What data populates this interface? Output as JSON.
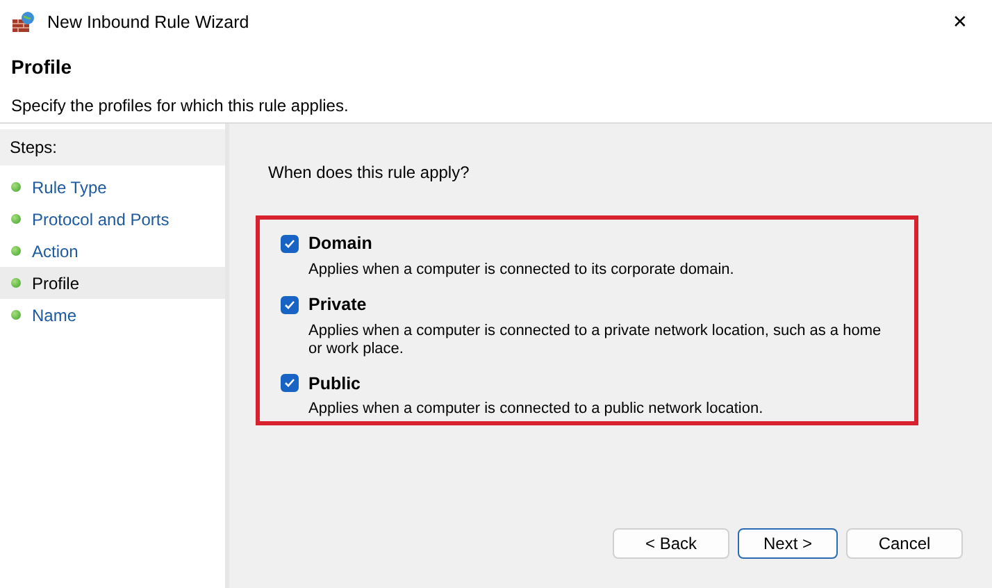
{
  "window": {
    "title": "New Inbound Rule Wizard",
    "close": "✕"
  },
  "header": {
    "title": "Profile",
    "subtitle": "Specify the profiles for which this rule applies."
  },
  "steps": {
    "heading": "Steps:",
    "items": [
      {
        "label": "Rule Type",
        "selected": false
      },
      {
        "label": "Protocol and Ports",
        "selected": false
      },
      {
        "label": "Action",
        "selected": false
      },
      {
        "label": "Profile",
        "selected": true
      },
      {
        "label": "Name",
        "selected": false
      }
    ]
  },
  "question": "When does this rule apply?",
  "profiles": [
    {
      "label": "Domain",
      "checked": true,
      "description": "Applies when a computer is connected to its corporate domain."
    },
    {
      "label": "Private",
      "checked": true,
      "description": "Applies when a computer is connected to a private network location, such as a home or work place."
    },
    {
      "label": "Public",
      "checked": true,
      "description": "Applies when a computer is connected to a public network location."
    }
  ],
  "buttons": [
    {
      "label": "< Back",
      "kind": "normal"
    },
    {
      "label": "Next >",
      "kind": "default"
    },
    {
      "label": "Cancel",
      "kind": "normal"
    }
  ]
}
